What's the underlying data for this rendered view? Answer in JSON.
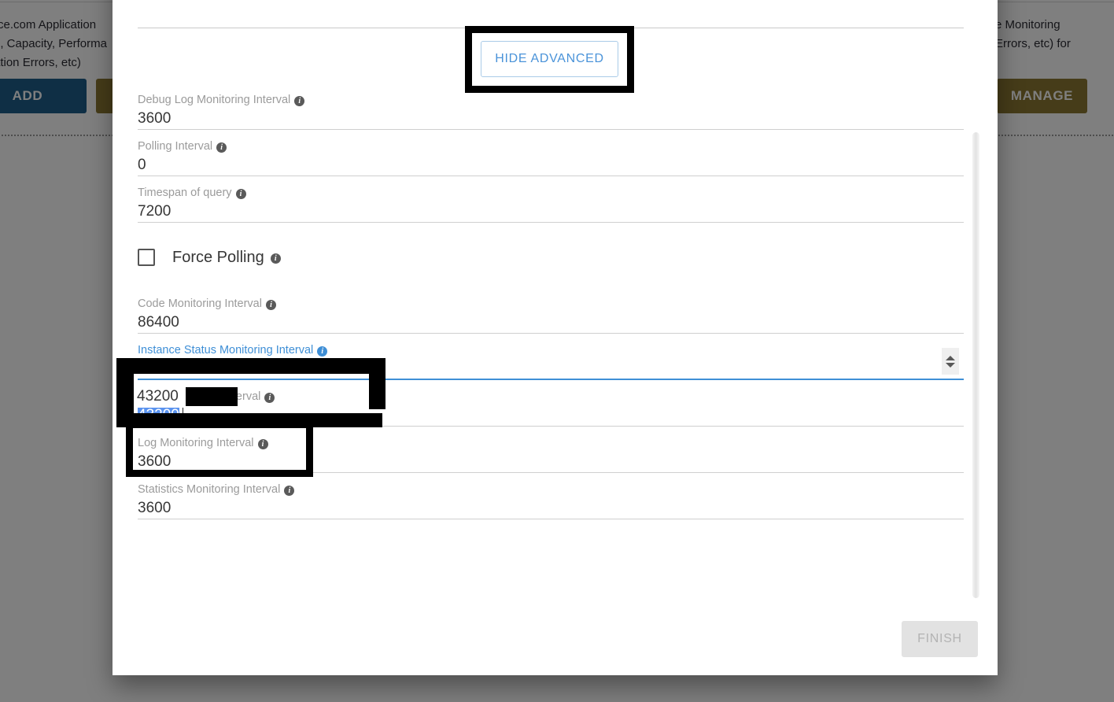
{
  "background": {
    "left_paragraph": "rce.com Application\ne, Capacity, Performa\nation Errors, etc)",
    "right_paragraph": "e Monitoring\nErrors, etc) for",
    "add_button": "ADD",
    "manage_button": "MANAGE",
    "add_button_color": "#1f5f8b",
    "manage_button_color": "#8d7832"
  },
  "modal": {
    "hide_advanced_label": "HIDE ADVANCED",
    "finish_label": "FINISH",
    "accent_blue": "#3f8fd6",
    "selection_blue": "#5a93ef",
    "fields": [
      {
        "label": "Debug Log Monitoring Interval",
        "value": "3600",
        "info": "info-icon",
        "state": "normal"
      },
      {
        "label": "Polling Interval",
        "value": "0",
        "info": "info-icon",
        "state": "normal"
      },
      {
        "label": "Timespan of query",
        "value": "7200",
        "info": "info-icon",
        "state": "normal"
      }
    ],
    "checkbox": {
      "label": "Force Polling",
      "checked": false,
      "info": "info-icon"
    },
    "fields_after_checkbox": [
      {
        "label": "Code Monitoring Interval",
        "value": "86400",
        "info": "info-icon",
        "state": "normal"
      },
      {
        "label": "Instance Status Monitoring Interval",
        "value": "43200",
        "info": "info-icon",
        "state": "focused"
      },
      {
        "label": "Audit Monitoring Interval",
        "value": "43200",
        "info": "info-icon",
        "state": "selected"
      },
      {
        "label": "Log Monitoring Interval",
        "value": "3600",
        "info": "info-icon",
        "state": "normal"
      },
      {
        "label": "Statistics Monitoring Interval",
        "value": "3600",
        "info": "info-icon",
        "state": "normal"
      }
    ]
  },
  "annotations": {
    "hide_advanced_highlight": "black-rectangle-outline",
    "instance_status_highlight": "black-rectangle-outline",
    "audit_highlight": "black-rectangle-outline",
    "redaction_bar": "black-redaction-bar"
  }
}
